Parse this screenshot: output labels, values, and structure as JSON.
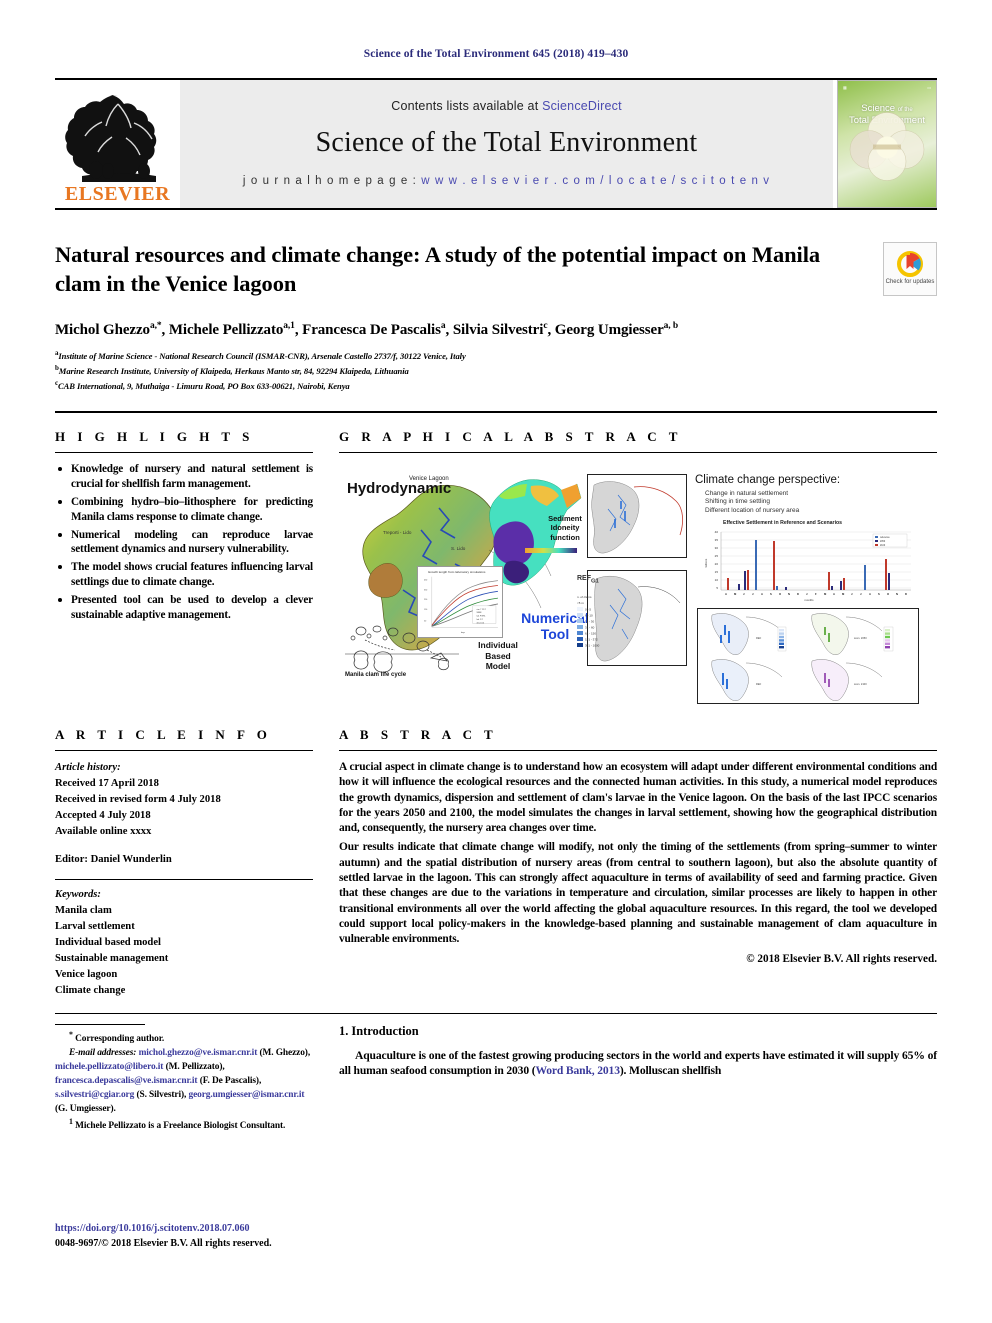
{
  "running_head": "Science of the Total Environment 645 (2018) 419–430",
  "masthead": {
    "contents_prefix": "Contents lists available at",
    "sciencedirect": "ScienceDirect",
    "journal_title": "Science of the Total Environment",
    "homepage_label": "j o u r n a l   h o m e p a g e :",
    "homepage_url": "w w w . e l s e v i e r . c o m / l o c a t e / s c i t o t e n v",
    "publisher": "ELSEVIER",
    "cover_title_line1": "Science",
    "cover_title_of": "of the",
    "cover_title_line2": "Total Environment"
  },
  "article": {
    "title": "Natural resources and climate change: A study of the potential impact on Manila clam in the Venice lagoon",
    "authors_html": "Michol Ghezzo, Michele Pellizzato, Francesca De Pascalis, Silvia Silvestri, Georg Umgiesser",
    "affiliations": [
      "Institute of Marine Science - National Research Council (ISMAR-CNR), Arsenale Castello 2737/f, 30122 Venice, Italy",
      "Marine Research Institute, University of Klaipeda, Herkaus Manto str, 84, 92294 Klaipeda, Lithuania",
      "CAB International, 9, Muthaiga - Limuru Road, PO Box 633-00621, Nairobi, Kenya"
    ],
    "crossmark_label": "Check for updates"
  },
  "highlights": {
    "heading": "H I G H L I G H T S",
    "items": [
      "Knowledge of nursery and natural settlement is crucial for shellfish farm management.",
      "Combining hydro–bio–lithosphere for predicting Manila clams response to climate change.",
      "Numerical modeling can reproduce larvae settlement dynamics and nursery vulnerability.",
      "The model shows crucial features influencing larval settlings due to climate change.",
      "Presented tool can be used to develop a clever sustainable adaptive management."
    ]
  },
  "article_info": {
    "heading": "A R T I C L E   I N F O",
    "history_label": "Article history:",
    "received": "Received 17 April 2018",
    "revised": "Received in revised form 4 July 2018",
    "accepted": "Accepted 4 July 2018",
    "available": "Available online xxxx",
    "editor": "Editor: Daniel Wunderlin",
    "keywords_label": "Keywords:",
    "keywords": [
      "Manila clam",
      "Larval settlement",
      "Individual based model",
      "Sustainable management",
      "Venice lagoon",
      "Climate change"
    ]
  },
  "graphical_abstract": {
    "heading": "G R A P H I C A L   A B S T R A C T",
    "labels": {
      "venice_lagoon": "Venice Lagoon",
      "hydrodynamic": "Hydrodynamic",
      "sediment": "Sediment\nIdoneity\nfunction",
      "numerical_tool": "Numerical\nTool",
      "ibm": "Individual\nBased\nModel",
      "lifecycle": "Manila clam life cycle",
      "growth_plot_title": "Growth length from laboratory simulations",
      "ref": "REF",
      "cc_title": "Climate change perspective:",
      "cc_b1": "Change in natural settlement",
      "cc_b2": "Shifting in time settling",
      "cc_b3": "Different location of nursery area",
      "chart_title": "Effective Settlement in Reference and Scenarios",
      "legend": [
        "reference",
        "2050",
        "2100"
      ]
    }
  },
  "chart_data": {
    "type": "bar",
    "title": "Effective Settlement in Reference and Scenarios",
    "xlabel": "months",
    "ylabel": "millions",
    "categories": [
      "A",
      "M",
      "J",
      "J",
      "A",
      "S",
      "O",
      "N",
      "D",
      "J",
      "F",
      "M",
      "A",
      "M",
      "J",
      "J",
      "A",
      "S",
      "O",
      "N",
      "D"
    ],
    "ylim": [
      0,
      40
    ],
    "yticks": [
      0,
      5,
      10,
      15,
      20,
      25,
      30,
      35,
      40
    ],
    "grid": true,
    "legend_position": "top-right",
    "series": [
      {
        "name": "reference",
        "color": "#3a6ab5",
        "values": [
          0,
          0.4,
          0.4,
          35,
          0,
          0.5,
          0.5,
          1,
          0,
          0,
          0,
          0,
          0,
          0,
          0,
          0,
          22,
          0,
          0,
          3,
          0
        ]
      },
      {
        "name": "2050",
        "color": "#2b2b7a",
        "values": [
          0,
          0.3,
          13,
          0.4,
          0,
          0.4,
          0.4,
          0.5,
          0,
          0,
          0,
          0,
          2,
          7,
          0,
          0,
          0,
          0,
          0,
          8,
          0
        ]
      },
      {
        "name": "2100",
        "color": "#c0392b",
        "values": [
          8,
          0,
          13,
          0,
          0,
          33,
          0,
          0,
          0,
          0,
          0,
          0,
          12,
          8,
          0,
          0,
          0,
          0,
          0,
          26,
          0
        ]
      }
    ]
  },
  "abstract": {
    "heading": "A B S T R A C T",
    "p1": "A crucial aspect in climate change is to understand how an ecosystem will adapt under different environmental conditions and how it will influence the ecological resources and the connected human activities. In this study, a numerical model reproduces the growth dynamics, dispersion and settlement of clam's larvae in the Venice lagoon. On the basis of the last IPCC scenarios for the years 2050 and 2100, the model simulates the changes in larval settlement, showing how the geographical distribution and, consequently, the nursery area changes over time.",
    "p2": "Our results indicate that climate change will modify, not only the timing of the settlements (from spring–summer to winter autumn) and the spatial distribution of nursery areas (from central to southern lagoon), but also the absolute quantity of settled larvae in the lagoon. This can strongly affect aquaculture in terms of availability of seed and farming practice. Given that these changes are due to the variations in temperature and circulation, similar processes are likely to happen in other transitional environments all over the world affecting the global aquaculture resources. In this regard, the tool we developed could support local policy-makers in the knowledge-based planning and sustainable management of clam aquaculture in vulnerable environments.",
    "copyright": "© 2018 Elsevier B.V. All rights reserved."
  },
  "footnotes": {
    "corresponding": "Corresponding author.",
    "email_label": "E-mail addresses:",
    "emails": [
      {
        "addr": "michol.ghezzo@ve.ismar.cnr.it",
        "who": "(M. Ghezzo)"
      },
      {
        "addr": "michele.pellizzato@libero.it",
        "who": "(M. Pellizzato)"
      },
      {
        "addr": "francesca.depascalis@ve.ismar.cnr.it",
        "who": "(F. De Pascalis)"
      },
      {
        "addr": "s.silvestri@cgiar.org",
        "who": "(S. Silvestri)"
      },
      {
        "addr": "georg.umgiesser@ismar.cnr.it",
        "who": "(G. Umgiesser)"
      }
    ],
    "note1": "Michele Pellizzato is a Freelance Biologist Consultant."
  },
  "introduction": {
    "number_and_title": "1.  Introduction",
    "paragraph_pre": "Aquaculture is one of the fastest growing producing sectors in the world and experts have estimated it will supply 65% of all human seafood consumption in 2030 (",
    "citation": "Word Bank, 2013",
    "paragraph_post": "). Molluscan shellfish"
  },
  "footer": {
    "doi": "https://doi.org/10.1016/j.scitotenv.2018.07.060",
    "issn_line": "0048-9697/© 2018 Elsevier B.V. All rights reserved."
  }
}
